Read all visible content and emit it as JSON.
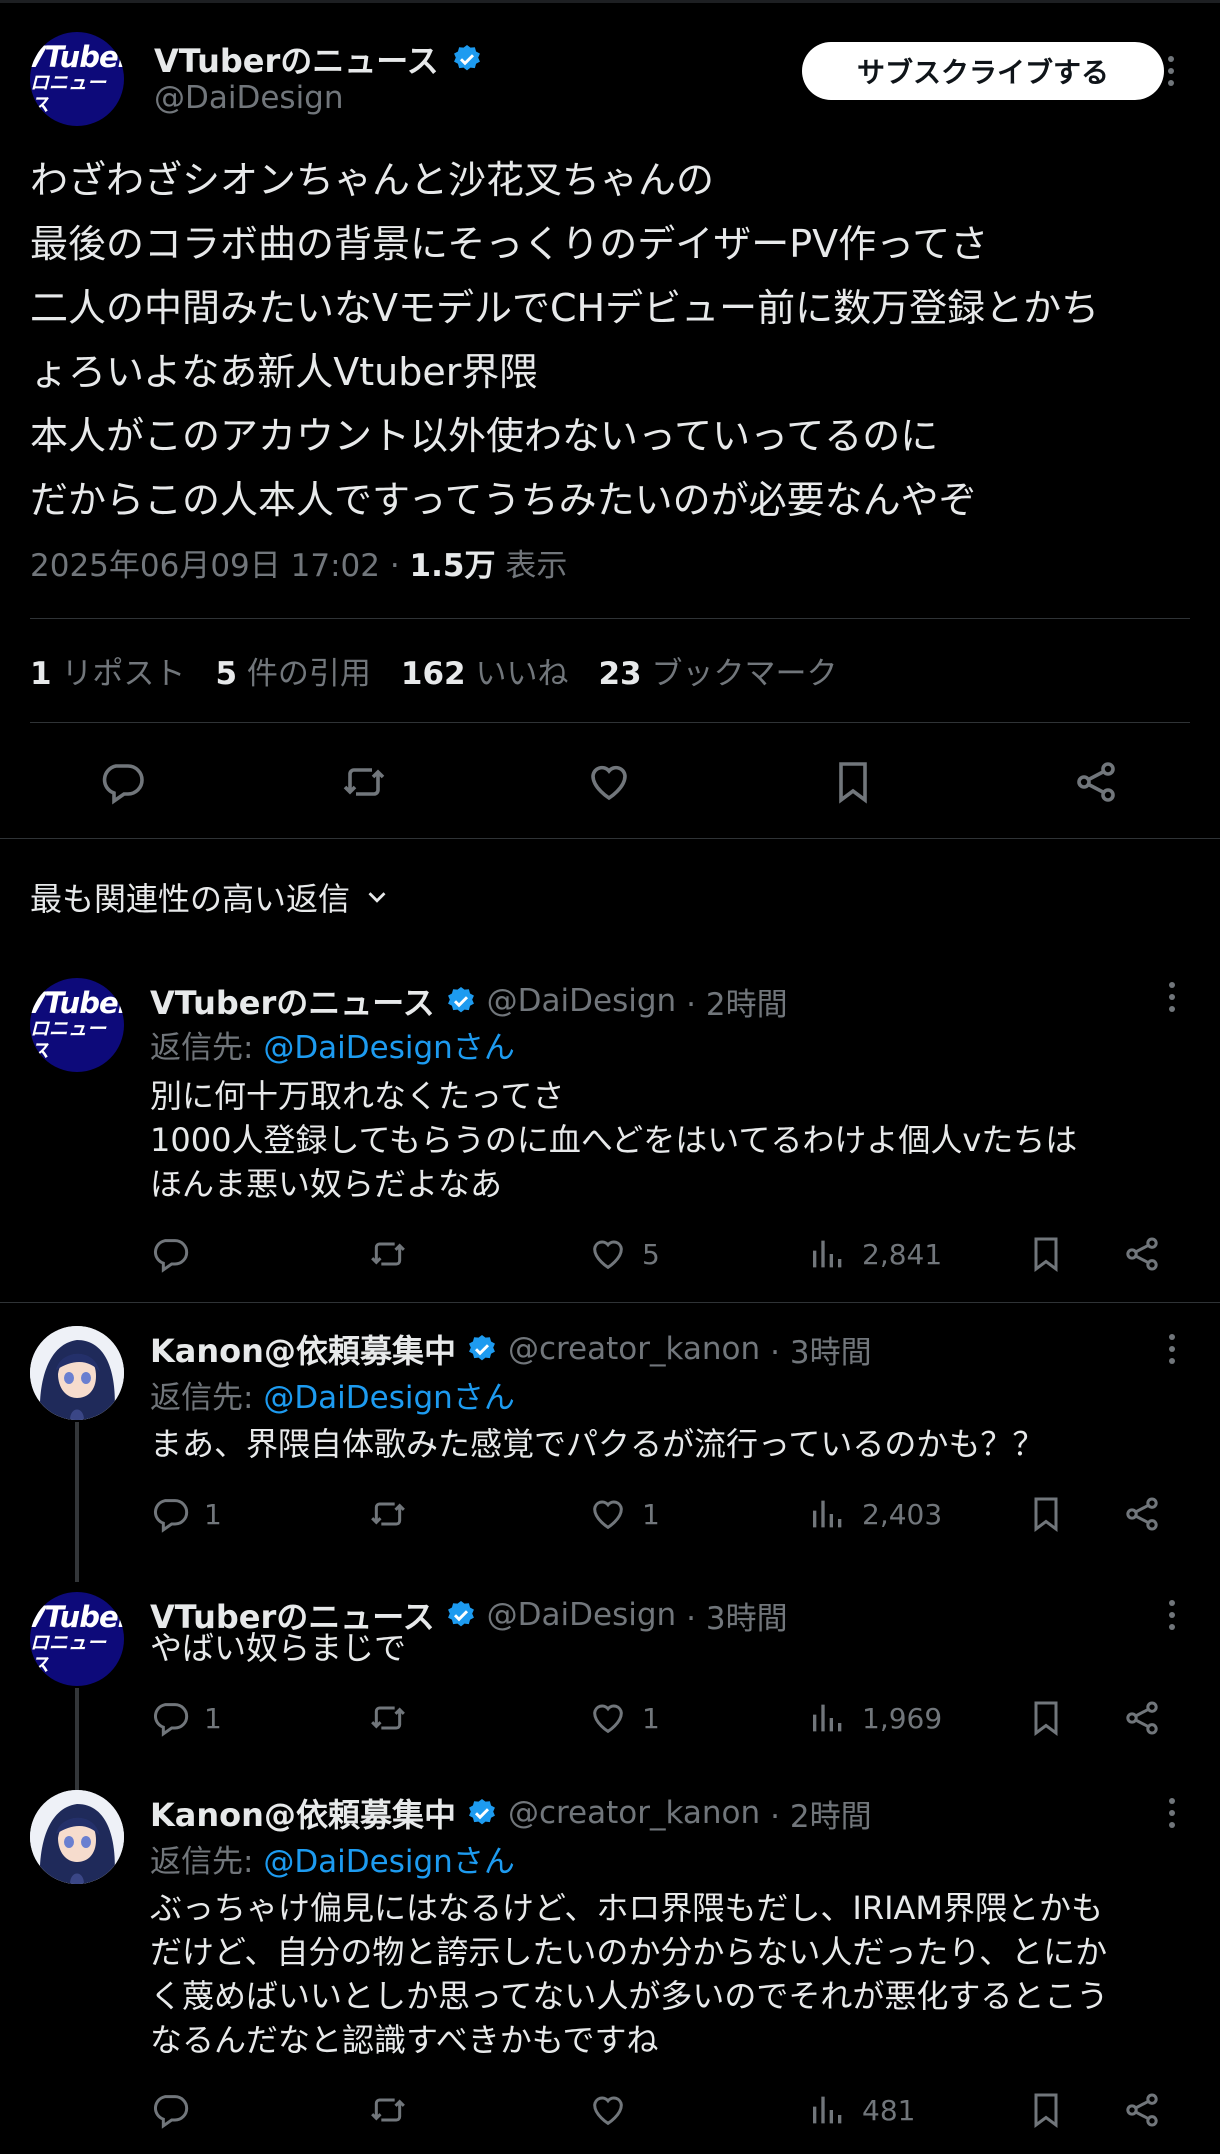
{
  "main_tweet": {
    "author_name": "VTuberのニュース",
    "handle": "@DaiDesign",
    "avatar": {
      "line1": "VTuber",
      "line2": "ロニュース"
    },
    "subscribe_label": "サブスクライブする",
    "text_lines": [
      "わざわざシオンちゃんと沙花叉ちゃんの",
      "最後のコラボ曲の背景にそっくりのデイザーPV作ってさ",
      "二人の中間みたいなVモデルでCHデビュー前に数万登録とかち",
      "ょろいよなあ新人Vtuber界隈",
      "本人がこのアカウント以外使わないっていってるのに",
      "だからこの人本人ですってうちみたいのが必要なんやぞ"
    ],
    "timestamp": "2025年06月09日 17:02 · ",
    "views_count": "1.5万",
    "views_label": " 表示",
    "stats": {
      "reposts_count": "1",
      "reposts_label": "リポスト",
      "quotes_count": "5",
      "quotes_label": "件の引用",
      "likes_count": "162",
      "likes_label": "いいね",
      "bookmarks_count": "23",
      "bookmarks_label": "ブックマーク"
    }
  },
  "sort_label": "最も関連性の高い返信",
  "replies": [
    {
      "author_name": "VTuberのニュース",
      "handle": "@DaiDesign",
      "time": "· 2時間",
      "reply_to_prefix": "返信先: ",
      "reply_to": "@DaiDesignさん",
      "lines": [
        "別に何十万取れなくたってさ",
        "1000人登録してもらうのに血へどをはいてるわけよ個人vたちは",
        "ほんま悪い奴らだよなあ"
      ],
      "replies": "",
      "reposts": "",
      "likes": "5",
      "views": "2,841"
    },
    {
      "author_name": "Kanon@依頼募集中",
      "handle": "@creator_kanon",
      "time": "· 3時間",
      "reply_to_prefix": "返信先: ",
      "reply_to": "@DaiDesignさん",
      "lines": [
        "まあ、界隈自体歌みた感覚でパクるが流行っているのかも？？"
      ],
      "replies": "1",
      "reposts": "",
      "likes": "1",
      "views": "2,403"
    },
    {
      "author_name": "VTuberのニュース",
      "handle": "@DaiDesign",
      "time": "· 3時間",
      "lines": [
        "やばい奴らまじで"
      ],
      "replies": "1",
      "reposts": "",
      "likes": "1",
      "views": "1,969"
    },
    {
      "author_name": "Kanon@依頼募集中",
      "handle": "@creator_kanon",
      "time": "· 2時間",
      "reply_to_prefix": "返信先: ",
      "reply_to": "@DaiDesignさん",
      "lines": [
        "ぶっちゃけ偏見にはなるけど、ホロ界隈もだし、IRIAM界隈とかも",
        "だけど、自分の物と誇示したいのか分からない人だったり、とにか",
        "く蔑めばいいとしか思ってない人が多いのでそれが悪化するとこう",
        "なるんだなと認識すべきかもですね"
      ],
      "replies": "",
      "reposts": "",
      "likes": "",
      "views": "481"
    }
  ],
  "colors": {
    "background": "#000000",
    "text": "#e7e9ea",
    "muted": "#71767b",
    "link": "#1d9bf0",
    "verified": "#1d9bf0",
    "avatar_bg": "#0d0a7a"
  },
  "icons": [
    "reply-icon",
    "repost-icon",
    "like-icon",
    "bookmark-icon",
    "share-icon",
    "views-icon",
    "verified-badge-icon",
    "more-icon",
    "chevron-down-icon"
  ]
}
